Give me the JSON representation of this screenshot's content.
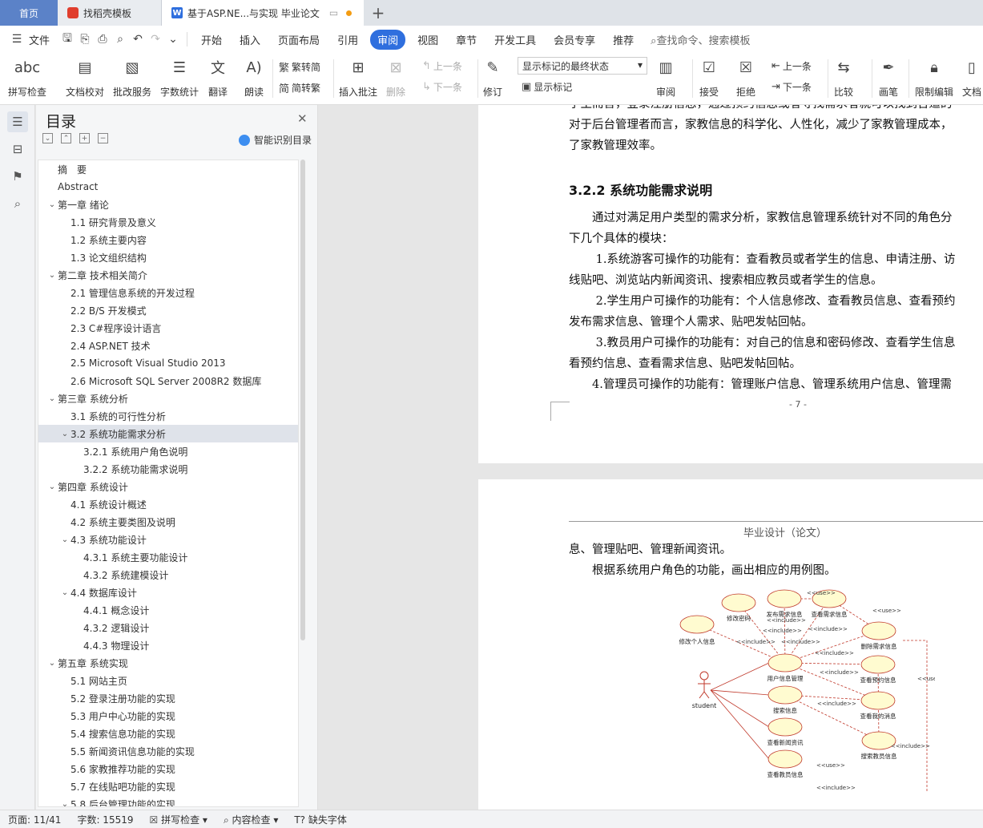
{
  "tabs": {
    "home": "首页",
    "template": "找稻壳模板",
    "doc": "基于ASP.NE...与实现 毕业论文",
    "add": "+"
  },
  "menu": {
    "file": "文件",
    "items": [
      "开始",
      "插入",
      "页面布局",
      "引用",
      "审阅",
      "视图",
      "章节",
      "开发工具",
      "会员专享",
      "推荐"
    ],
    "active_index": 4,
    "search": "查找命令、搜索模板"
  },
  "ribbon": {
    "spell": "拼写检查",
    "doc_check": "文档校对",
    "approve": "批改服务",
    "word_count": "字数统计",
    "translate": "翻译",
    "read_aloud": "朗读",
    "to_trad": "繁转简",
    "to_simp": "简转繁",
    "insert_comment": "插入批注",
    "delete": "删除",
    "prev": "上一条",
    "next": "下一条",
    "track": "修订",
    "display_state": "显示标记的最终状态",
    "show_marks": "显示标记",
    "review": "审阅",
    "accept": "接受",
    "reject": "拒绝",
    "prev2": "上一条",
    "next2": "下一条",
    "compare": "比较",
    "pen": "画笔",
    "restrict": "限制编辑",
    "doc_permission": "文档"
  },
  "toc": {
    "title": "目录",
    "smart": "智能识别目录",
    "items": [
      {
        "text": "摘　要",
        "level": 0,
        "caret": ""
      },
      {
        "text": "Abstract",
        "level": 0,
        "caret": ""
      },
      {
        "text": "第一章  绪论",
        "level": 0,
        "caret": "v"
      },
      {
        "text": "1.1 研究背景及意义",
        "level": 1,
        "caret": ""
      },
      {
        "text": "1.2 系统主要内容",
        "level": 1,
        "caret": ""
      },
      {
        "text": "1.3 论文组织结构",
        "level": 1,
        "caret": ""
      },
      {
        "text": "第二章  技术相关简介",
        "level": 0,
        "caret": "v"
      },
      {
        "text": "2.1 管理信息系统的开发过程",
        "level": 1,
        "caret": ""
      },
      {
        "text": "2.2 B/S  开发模式",
        "level": 1,
        "caret": ""
      },
      {
        "text": "2.3 C#程序设计语言",
        "level": 1,
        "caret": ""
      },
      {
        "text": "2.4 ASP.NET  技术",
        "level": 1,
        "caret": ""
      },
      {
        "text": "2.5 Microsoft Visual Studio 2013",
        "level": 1,
        "caret": ""
      },
      {
        "text": "2.6 Microsoft SQL Server 2008R2 数据库",
        "level": 1,
        "caret": ""
      },
      {
        "text": "第三章  系统分析",
        "level": 0,
        "caret": "v"
      },
      {
        "text": "3.1 系统的可行性分析",
        "level": 1,
        "caret": ""
      },
      {
        "text": "3.2 系统功能需求分析",
        "level": 1,
        "caret": "v",
        "selected": true
      },
      {
        "text": "3.2.1 系统用户角色说明",
        "level": 2,
        "caret": ""
      },
      {
        "text": "3.2.2 系统功能需求说明",
        "level": 2,
        "caret": ""
      },
      {
        "text": "第四章  系统设计",
        "level": 0,
        "caret": "v"
      },
      {
        "text": "4.1 系统设计概述",
        "level": 1,
        "caret": ""
      },
      {
        "text": "4.2  系统主要类图及说明",
        "level": 1,
        "caret": ""
      },
      {
        "text": "4.3 系统功能设计",
        "level": 1,
        "caret": "v"
      },
      {
        "text": "4.3.1 系统主要功能设计",
        "level": 2,
        "caret": ""
      },
      {
        "text": "4.3.2 系统建模设计",
        "level": 2,
        "caret": ""
      },
      {
        "text": "4.4 数据库设计",
        "level": 1,
        "caret": "v"
      },
      {
        "text": "4.4.1  概念设计",
        "level": 2,
        "caret": ""
      },
      {
        "text": "4.3.2  逻辑设计",
        "level": 2,
        "caret": ""
      },
      {
        "text": "4.4.3  物理设计",
        "level": 2,
        "caret": ""
      },
      {
        "text": "第五章  系统实现",
        "level": 0,
        "caret": "v"
      },
      {
        "text": "5.1 网站主页",
        "level": 1,
        "caret": ""
      },
      {
        "text": "5.2  登录注册功能的实现",
        "level": 1,
        "caret": ""
      },
      {
        "text": "5.3 用户中心功能的实现",
        "level": 1,
        "caret": ""
      },
      {
        "text": "5.4 搜索信息功能的实现",
        "level": 1,
        "caret": ""
      },
      {
        "text": "5.5 新闻资讯信息功能的实现",
        "level": 1,
        "caret": ""
      },
      {
        "text": "5.6 家教推荐功能的实现",
        "level": 1,
        "caret": ""
      },
      {
        "text": "5.7 在线贴吧功能的实现",
        "level": 1,
        "caret": ""
      },
      {
        "text": "5.8 后台管理功能的实现",
        "level": 1,
        "caret": "v"
      }
    ]
  },
  "page1": {
    "lines": [
      "学生而言，登录注册信息，通过预约信息或者寻找需求者就可以找到合适的",
      "对于后台管理者而言，家教信息的科学化、人性化，减少了家教管理成本，",
      "了家教管理效率。"
    ],
    "heading": "3.2.2 系统功能需求说明",
    "body": [
      "　　通过对满足用户类型的需求分析，家教信息管理系统针对不同的角色分",
      "下几个具体的模块：",
      "　　 1.系统游客可操作的功能有：查看教员或者学生的信息、申请注册、访",
      "线贴吧、浏览站内新闻资讯、搜索相应教员或者学生的信息。",
      "　　 2.学生用户可操作的功能有：个人信息修改、查看教员信息、查看预约",
      "发布需求信息、管理个人需求、贴吧发帖回帖。",
      "　　 3.教员用户可操作的功能有：对自己的信息和密码修改、查看学生信息",
      "看预约信息、查看需求信息、贴吧发帖回帖。",
      "　　4.管理员可操作的功能有：管理账户信息、管理系统用户信息、管理需"
    ],
    "page_number": "- 7 -"
  },
  "page2": {
    "header": "毕业设计（论文）",
    "lines": [
      "息、管理贴吧、管理新闻资讯。",
      "　　根据系统用户角色的功能，画出相应的用例图。"
    ],
    "diagram": {
      "actor": "student",
      "nodes": [
        "修改密码",
        "发布需求信息",
        "查看需求信息",
        "修改个人信息",
        "删除需求信息",
        "用户信息管理",
        "查看预约信息",
        "搜索信息",
        "查看我的消息",
        "查看新闻资讯",
        "搜索教员信息",
        "查看教员信息"
      ],
      "rels": [
        "<<use>>",
        "<<use>>",
        "<<include>>",
        "<<include>>",
        "<<include>>",
        "<<include>>",
        "<<include>>",
        "<<include>>",
        "<<include>>",
        "<<include>>",
        "<<use>>",
        "<<use>>",
        "<<include>>",
        "<<include>>"
      ]
    }
  },
  "status": {
    "page": "页面: 11/41",
    "words": "字数: 15519",
    "spell": "拼写检查",
    "content": "内容检查",
    "missing_font": "缺失字体"
  }
}
